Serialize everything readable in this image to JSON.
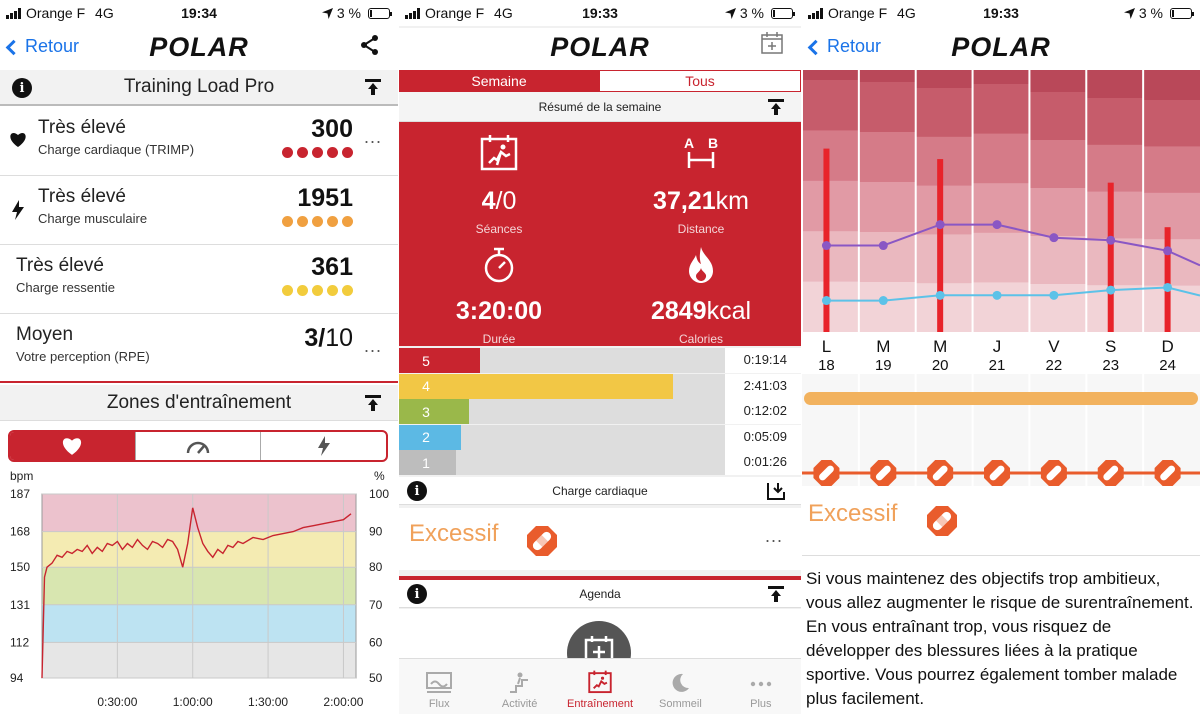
{
  "statusbars": [
    {
      "carrier": "Orange F",
      "network": "4G",
      "time": "19:34",
      "battery": "3 %"
    },
    {
      "carrier": "Orange F",
      "network": "4G",
      "time": "19:33",
      "battery": "3 %"
    },
    {
      "carrier": "Orange F",
      "network": "4G",
      "time": "19:33",
      "battery": "3 %"
    }
  ],
  "brand": "POLAR",
  "back_label": "Retour",
  "p1": {
    "section_title": "Training Load Pro",
    "rows": [
      {
        "level": "Très élevé",
        "label": "Charge cardiaque (TRIMP)",
        "value": "300",
        "dot_color": "#c8242f"
      },
      {
        "level": "Très élevé",
        "label": "Charge musculaire",
        "value": "1951",
        "dot_color": "#f0a040"
      },
      {
        "level": "Très élevé",
        "label": "Charge ressentie",
        "value": "361",
        "dot_color": "#f2cc3c"
      },
      {
        "level": "Moyen",
        "label": "Votre perception (RPE)",
        "value_main": "3",
        "value_sep": "/",
        "value_rest": "10"
      }
    ],
    "more": "...",
    "zones_title": "Zones d'entraînement",
    "icons": {
      "row1": "heart-icon",
      "row2": "lightning-icon",
      "seg": [
        "heart-icon",
        "gauge-icon",
        "lightning-icon"
      ]
    }
  },
  "chart_data": {
    "type": "line",
    "xlabel": "",
    "ylabel_left": "bpm",
    "ylabel_right": "%",
    "y_ticks": [
      94,
      112,
      131,
      150,
      168,
      187
    ],
    "y_right_ticks": [
      50,
      60,
      70,
      80,
      90,
      100
    ],
    "x_ticks": [
      "0:30:00",
      "1:00:00",
      "1:30:00",
      "2:00:00"
    ],
    "ylim": [
      94,
      187
    ],
    "xlim_min": [
      0,
      125
    ],
    "zones": [
      {
        "from": 94,
        "to": 112,
        "color": "#e6e6e6"
      },
      {
        "from": 112,
        "to": 131,
        "color": "#bde3f2"
      },
      {
        "from": 131,
        "to": 150,
        "color": "#d8e6b0"
      },
      {
        "from": 150,
        "to": 168,
        "color": "#f4ebb2"
      },
      {
        "from": 168,
        "to": 187,
        "color": "#ecc2cd"
      }
    ],
    "series": [
      {
        "color": "#c8242f",
        "x": [
          0,
          1,
          2,
          4,
          6,
          8,
          10,
          12,
          14,
          16,
          18,
          20,
          22,
          24,
          26,
          28,
          30,
          32,
          34,
          36,
          38,
          40,
          42,
          44,
          46,
          48,
          50,
          52,
          54,
          56,
          58,
          60,
          62,
          64,
          66,
          68,
          70,
          72,
          74,
          76,
          78,
          80,
          84,
          88,
          92,
          96,
          100,
          104,
          108,
          112,
          116,
          120,
          123
        ],
        "y": [
          94,
          145,
          150,
          152,
          156,
          155,
          158,
          157,
          159,
          158,
          161,
          157,
          160,
          158,
          162,
          161,
          163,
          159,
          162,
          160,
          164,
          161,
          159,
          163,
          162,
          160,
          164,
          163,
          159,
          150,
          162,
          180,
          170,
          162,
          158,
          155,
          159,
          157,
          161,
          160,
          163,
          162,
          165,
          164,
          166,
          167,
          168,
          170,
          171,
          172,
          173,
          174,
          177
        ]
      }
    ]
  },
  "p2": {
    "tabs": [
      "Semaine",
      "Tous"
    ],
    "week_summary_title": "Résumé de la semaine",
    "stats": [
      {
        "value_main": "4",
        "value_rest": "/0",
        "label": "Séances",
        "icon": "workout-icon"
      },
      {
        "value_main": "37,21",
        "value_rest": "km",
        "label": "Distance",
        "icon": "distance-ab-icon"
      },
      {
        "value_main": "3:20:00",
        "value_rest": "",
        "label": "Durée",
        "icon": "stopwatch-icon"
      },
      {
        "value_main": "2849",
        "value_rest": "kcal",
        "label": "Calories",
        "icon": "flame-icon"
      }
    ],
    "zones": [
      {
        "zone": "5",
        "time": "0:19:14",
        "fraction": 0.1,
        "color": "#c8242f"
      },
      {
        "zone": "4",
        "time": "2:41:03",
        "fraction": 0.81,
        "color": "#f2c745"
      },
      {
        "zone": "3",
        "time": "0:12:02",
        "fraction": 0.06,
        "color": "#9ab84a"
      },
      {
        "zone": "2",
        "time": "0:05:09",
        "fraction": 0.03,
        "color": "#5cb9e4"
      },
      {
        "zone": "1",
        "time": "0:01:26",
        "fraction": 0.01,
        "color": "#bdbdbd"
      }
    ],
    "cardiac_title": "Charge cardiaque",
    "cardiac_status": "Excessif",
    "more": "...",
    "agenda_title": "Agenda",
    "bottom_nav": [
      {
        "label": "Flux",
        "icon": "feed-icon"
      },
      {
        "label": "Activité",
        "icon": "activity-icon"
      },
      {
        "label": "Entraînement",
        "icon": "training-icon"
      },
      {
        "label": "Sommeil",
        "icon": "moon-icon"
      },
      {
        "label": "Plus",
        "icon": "more-icon"
      }
    ],
    "accent": "#c8242f"
  },
  "p3": {
    "days": [
      {
        "letter": "L",
        "num": "18"
      },
      {
        "letter": "M",
        "num": "19"
      },
      {
        "letter": "M",
        "num": "20"
      },
      {
        "letter": "J",
        "num": "21"
      },
      {
        "letter": "V",
        "num": "22"
      },
      {
        "letter": "S",
        "num": "23"
      },
      {
        "letter": "D",
        "num": "24"
      }
    ],
    "bar_values": [
      0.7,
      0.0,
      0.66,
      0.0,
      0.0,
      0.57,
      0.4
    ],
    "purple_line": [
      0.33,
      0.33,
      0.41,
      0.41,
      0.36,
      0.35,
      0.31
    ],
    "blue_line": [
      0.12,
      0.12,
      0.14,
      0.14,
      0.14,
      0.16,
      0.17
    ],
    "status": "Excessif",
    "text": "Si vous maintenez des objectifs trop ambitieux, vous allez augmenter le risque de surentraînement. En vous entraînant trop, vous risquez de développer des blessures liées à la pratique sportive. Vous pourrez également tomber malade plus facilement."
  }
}
